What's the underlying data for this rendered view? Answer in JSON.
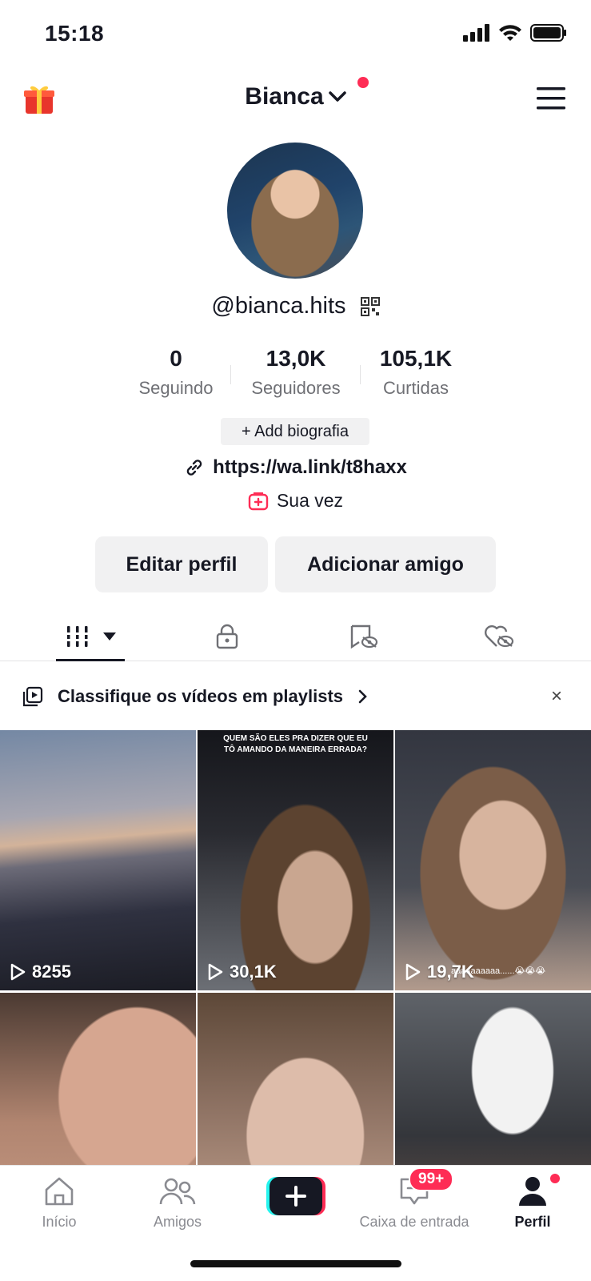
{
  "status_bar": {
    "time": "15:18"
  },
  "header": {
    "profile_name": "Bianca"
  },
  "profile": {
    "username": "@bianca.hits",
    "stats": [
      {
        "value": "0",
        "label": "Seguindo"
      },
      {
        "value": "13,0K",
        "label": "Seguidores"
      },
      {
        "value": "105,1K",
        "label": "Curtidas"
      }
    ],
    "add_bio_label": "+ Add biografia",
    "link": "https://wa.link/t8haxx",
    "sua_vez_label": "Sua vez",
    "edit_profile_label": "Editar perfil",
    "add_friend_label": "Adicionar amigo"
  },
  "playlist_banner": {
    "text": "Classifique os vídeos em playlists",
    "close": "×"
  },
  "videos": [
    {
      "views": "8255"
    },
    {
      "views": "30,1K",
      "caption": "QUEM SÃO ELES PRA DIZER QUE EU\nTÔ AMANDO DA MANEIRA ERRADA?"
    },
    {
      "views": "19,7K",
      "caption": "aaaaaaaaaa......😭😭😭"
    },
    {
      "views": ""
    },
    {
      "views": ""
    },
    {
      "views": ""
    }
  ],
  "nav": {
    "home": "Início",
    "friends": "Amigos",
    "inbox": "Caixa de entrada",
    "inbox_badge": "99+",
    "profile": "Perfil"
  },
  "colors": {
    "accent": "#fe2c55",
    "text": "#161823",
    "muted": "#6f7075",
    "button_bg": "#f1f1f2"
  }
}
